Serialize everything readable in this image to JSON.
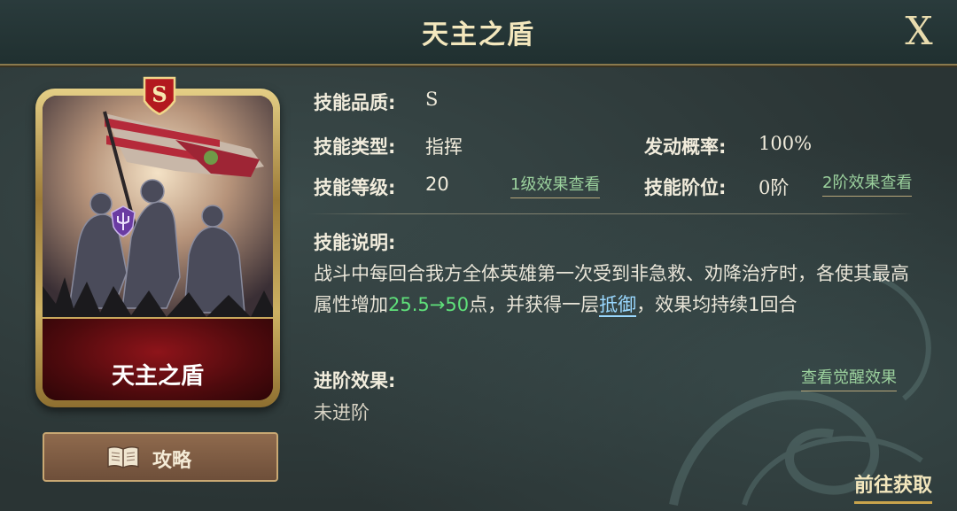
{
  "header": {
    "title": "天主之盾",
    "close_label": "X"
  },
  "card": {
    "name": "天主之盾",
    "grade": "S",
    "emblem_icon": "trident-shield-icon"
  },
  "guide_button": {
    "label": "攻略",
    "icon": "book-icon"
  },
  "info": {
    "quality_label": "技能品质:",
    "quality_value": "S",
    "type_label": "技能类型:",
    "type_value": "指挥",
    "level_label": "技能等级:",
    "level_value": "20",
    "level_effect_link": "1级效果查看",
    "rate_label": "发动概率:",
    "rate_value": "100%",
    "rank_label": "技能阶位:",
    "rank_value": "0阶",
    "rank_effect_link": "2阶效果查看"
  },
  "description": {
    "label": "技能说明:",
    "part1": "战斗中每回合我方全体英雄第一次受到非急救、劝降治疗时，各使其最高属性增加",
    "value_highlight": "25.5→50",
    "part2": "点，并获得一层",
    "term": "抵御",
    "part3": "，效果均持续1回合"
  },
  "advance": {
    "label": "进阶效果:",
    "value": "未进阶",
    "awaken_link": "查看觉醒效果"
  },
  "footer": {
    "get_link": "前往获取"
  },
  "colors": {
    "accent_gold": "#f3e7bd",
    "link_green": "#9bd19d",
    "highlight_green": "#5fe07a",
    "term_blue": "#9ad8ff",
    "card_red": "#8e141a"
  }
}
